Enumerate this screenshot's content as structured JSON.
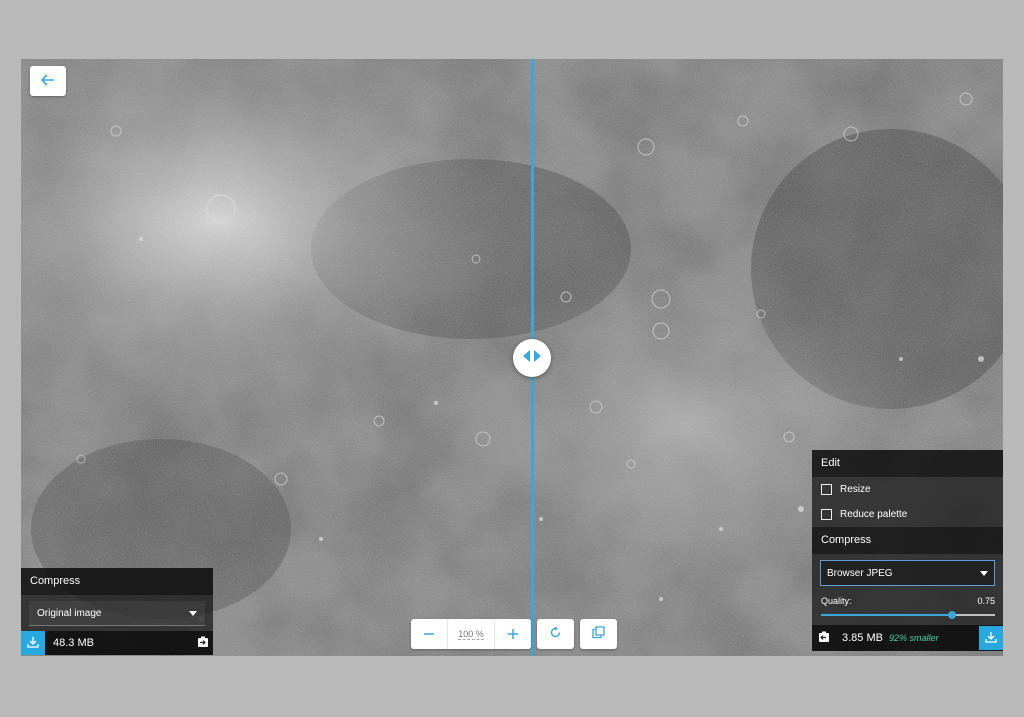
{
  "navigation": {
    "back_icon": "arrow-left-icon"
  },
  "divider": {
    "handle_icon": "left-right-arrows-icon",
    "color": "#3aa6d9"
  },
  "left_panel": {
    "title": "Compress",
    "method_selected": "Original image",
    "file_size": "48.3 MB",
    "download_icon": "download-icon",
    "copy_icon": "copy-to-other-side-icon"
  },
  "right_panel": {
    "edit_title": "Edit",
    "edit_options": [
      {
        "label": "Resize",
        "checked": false
      },
      {
        "label": "Reduce palette",
        "checked": false
      }
    ],
    "compress_title": "Compress",
    "method_selected": "Browser JPEG",
    "quality_label": "Quality:",
    "quality_value": "0.75",
    "quality_fraction": 0.75,
    "file_size": "3.85 MB",
    "savings": "92% smaller",
    "download_icon": "download-icon",
    "copy_icon": "copy-to-other-side-icon"
  },
  "toolbar": {
    "zoom_out_icon": "minus-icon",
    "zoom_value": "100 %",
    "zoom_in_icon": "plus-icon",
    "rotate_icon": "rotate-icon",
    "toggle_background_icon": "background-toggle-icon"
  },
  "colors": {
    "accent": "#3aa6d9",
    "download_button": "#29a8e0",
    "savings_text": "#3dd6a6"
  }
}
